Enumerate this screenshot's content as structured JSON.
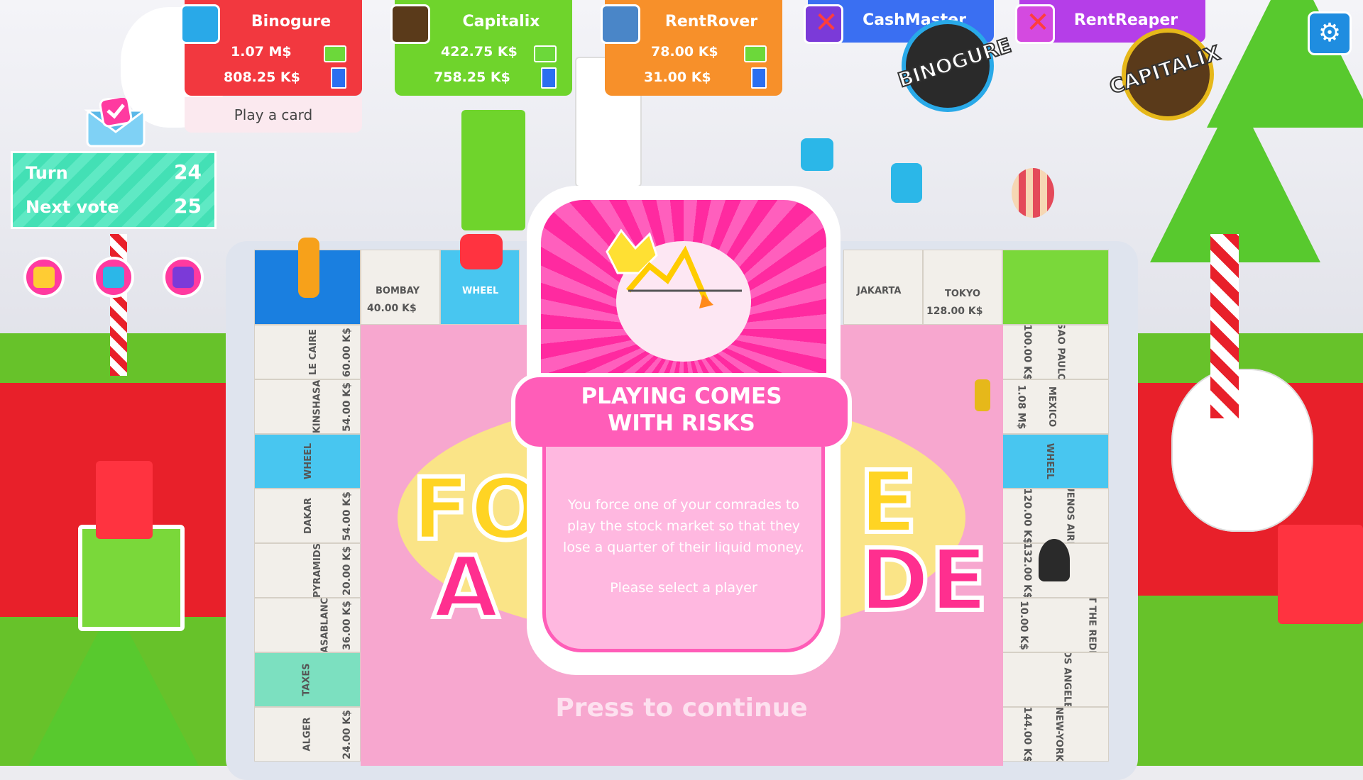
{
  "players": [
    {
      "name": "Binogure",
      "money": "1.07 M$",
      "wealth": "808.25 K$",
      "color": "#f2383f",
      "avatar": "joystick-icon",
      "action_label": "Play a card"
    },
    {
      "name": "Capitalix",
      "money": "422.75 K$",
      "wealth": "758.25 K$",
      "color": "#6fd42c",
      "avatar": "gold-coins-icon"
    },
    {
      "name": "RentRover",
      "money": "78.00 K$",
      "wealth": "31.00 K$",
      "color": "#f7902a",
      "avatar": "astronaut-icon"
    },
    {
      "name": "CashMaster",
      "color": "#3a6ff2",
      "eliminated": true
    },
    {
      "name": "RentReaper",
      "color": "#b53ee8",
      "eliminated": true
    }
  ],
  "turn_info": {
    "turn_label": "Turn",
    "turn_value": "24",
    "vote_label": "Next vote",
    "vote_value": "25"
  },
  "badges": {
    "binogure": "BINOGURE",
    "capitalix": "CAPITALIX"
  },
  "board_tiles": {
    "top": [
      {
        "name": "BOMBAY",
        "price": "40.00 K$"
      },
      {
        "name": "WHEEL",
        "price": ""
      },
      {
        "name": "JAKARTA",
        "price": ""
      },
      {
        "name": "TOKYO",
        "price": "128.00 K$"
      }
    ],
    "left": [
      {
        "name": "LE CAIRE",
        "price": "60.00 K$"
      },
      {
        "name": "KINSHASA",
        "price": "54.00 K$"
      },
      {
        "name": "WHEEL",
        "price": ""
      },
      {
        "name": "DAKAR",
        "price": "54.00 K$"
      },
      {
        "name": "PYRAMIDS",
        "price": "20.00 K$"
      },
      {
        "name": "CASABLANCA",
        "price": "36.00 K$"
      },
      {
        "name": "TAXES",
        "price": ""
      },
      {
        "name": "ALGER",
        "price": "24.00 K$"
      }
    ],
    "right": [
      {
        "name": "SAO PAULO",
        "price": "100.00 K$"
      },
      {
        "name": "MEXICO",
        "price": "1.08 M$"
      },
      {
        "name": "WHEEL",
        "price": ""
      },
      {
        "name": "BUENOS AIRES",
        "price": "120.00 K$"
      },
      {
        "name": "",
        "price": "132.00 K$"
      },
      {
        "name": "CHRIST THE REDEEMER",
        "price": "10.00 K$"
      },
      {
        "name": "LOS ANGELES",
        "price": ""
      },
      {
        "name": "NEW-YORK",
        "price": "144.00 K$"
      }
    ]
  },
  "board_logo": {
    "line1_left": "FO",
    "line1_right": "E",
    "line2_left": "A",
    "line2_right": "DE"
  },
  "modal": {
    "title": "PLAYING COMES WITH RISKS",
    "description": "You force one of your comrades to play the stock market so that they lose a quarter of their liquid money.",
    "prompt": "Please select a player",
    "icon": "stock-crash-icon"
  },
  "continue_text": "Press to continue",
  "icons": {
    "settings": "gear-icon",
    "mail": "mail-check-icon",
    "buttons": [
      "city-icon",
      "dice-icon",
      "festival-icon"
    ]
  }
}
